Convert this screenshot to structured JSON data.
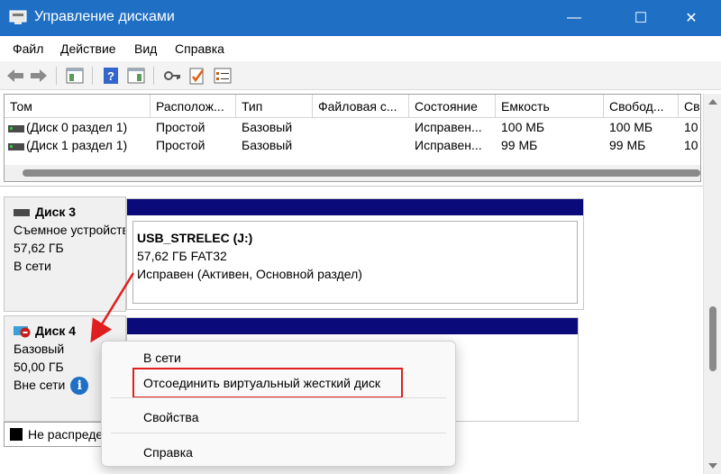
{
  "window": {
    "title": "Управление дисками",
    "minimize": "—",
    "maximize": "☐",
    "close": "✕"
  },
  "menu": [
    "Файл",
    "Действие",
    "Вид",
    "Справка"
  ],
  "list": {
    "columns": [
      "Том",
      "Располож...",
      "Тип",
      "Файловая с...",
      "Состояние",
      "Емкость",
      "Свобод...",
      "Св"
    ],
    "rows": [
      [
        "(Диск 0 раздел 1)",
        "Простой",
        "Базовый",
        "",
        "Исправен...",
        "100 МБ",
        "100 МБ",
        "10"
      ],
      [
        "(Диск 1 раздел 1)",
        "Простой",
        "Базовый",
        "",
        "Исправен...",
        "99 МБ",
        "99 МБ",
        "10"
      ]
    ]
  },
  "disks": [
    {
      "name": "Диск 3",
      "type": "Съемное устройство",
      "size": "57,62 ГБ",
      "status": "В сети",
      "volume": {
        "label": "USB_STRELEC  (J:)",
        "size_fs": "57,62 ГБ FAT32",
        "state": "Исправен (Активен, Основной раздел)"
      }
    },
    {
      "name": "Диск 4",
      "type": "Базовый",
      "size": "50,00 ГБ",
      "status": "Вне сети"
    }
  ],
  "legend": {
    "unallocated": "Не распределена"
  },
  "context_menu": {
    "items": [
      "В сети",
      "Отсоединить виртуальный жесткий диск",
      "Свойства",
      "Справка"
    ]
  },
  "colors": {
    "titlebar": "#1f6fc4",
    "volume_bar": "#0a0a7a",
    "highlight": "#e02020",
    "annotation_arrow": "#e02020"
  }
}
